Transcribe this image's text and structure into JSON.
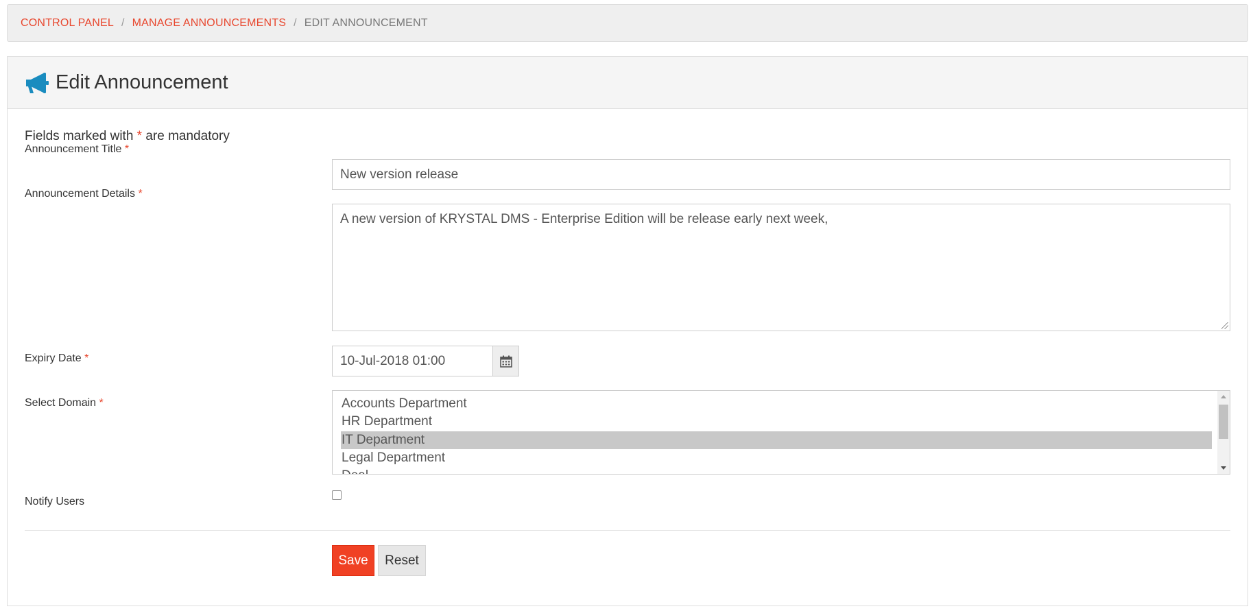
{
  "breadcrumb": {
    "items": [
      {
        "label": "CONTROL PANEL"
      },
      {
        "label": "MANAGE ANNOUNCEMENTS"
      }
    ],
    "current": "EDIT ANNOUNCEMENT",
    "separator": "/"
  },
  "panel": {
    "icon": "megaphone-icon",
    "title": "Edit Announcement"
  },
  "form": {
    "note_prefix": "Fields marked with",
    "note_star": "*",
    "note_suffix": "are mandatory",
    "required_mark": "*",
    "title": {
      "label": "Announcement Title",
      "value": "New version release"
    },
    "details": {
      "label": "Announcement Details",
      "value": "A new version of KRYSTAL DMS  - Enterprise Edition will be release early next week,"
    },
    "expiry": {
      "label": "Expiry Date",
      "value": "10-Jul-2018 01:00",
      "icon": "calendar-icon"
    },
    "domain": {
      "label": "Select Domain",
      "options": [
        "Accounts Department",
        "HR Department",
        "IT Department",
        "Legal Department",
        "Deal..."
      ],
      "selected": "IT Department"
    },
    "notify": {
      "label": "Notify Users",
      "checked": false
    },
    "save_label": "Save",
    "reset_label": "Reset"
  },
  "colors": {
    "accent": "#e8472e",
    "save_button": "#f04124",
    "icon": "#1a8cbf"
  }
}
